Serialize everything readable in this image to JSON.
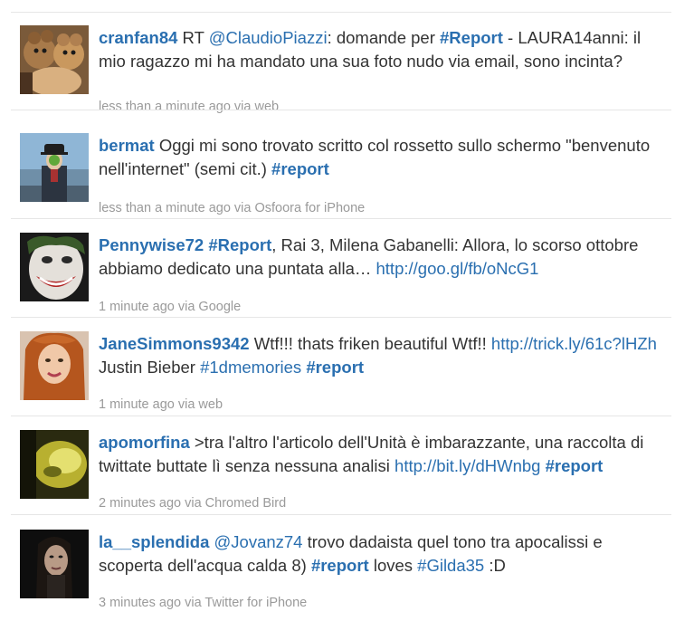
{
  "tweets": [
    {
      "user": "cranfan84",
      "segments": [
        {
          "type": "text",
          "text": " RT "
        },
        {
          "type": "mention",
          "text": "@ClaudioPiazzi"
        },
        {
          "type": "text",
          "text": ": domande per "
        },
        {
          "type": "hashtag",
          "text": "#Report"
        },
        {
          "type": "text",
          "text": " - LAURA14anni: il mio ragazzo mi ha mandato una sua foto nudo via email, sono incinta?"
        }
      ],
      "meta": "less than a minute ago via web",
      "avatar": "teddy-bear-avatar"
    },
    {
      "user": "bermat",
      "segments": [
        {
          "type": "text",
          "text": " Oggi mi sono trovato scritto col rossetto sullo schermo \"benvenuto nell'internet\" (semi cit.) "
        },
        {
          "type": "hashtag",
          "text": "#report"
        }
      ],
      "meta": "less than a minute ago via Osfoora for iPhone",
      "avatar": "magritte-man-avatar"
    },
    {
      "user": "Pennywise72",
      "segments": [
        {
          "type": "text",
          "text": " "
        },
        {
          "type": "hashtag",
          "text": "#Report"
        },
        {
          "type": "text",
          "text": ", Rai 3, Milena Gabanelli: Allora, lo scorso ottobre abbiamo dedicato una puntata alla… "
        },
        {
          "type": "link",
          "text": "http://goo.gl/fb/oNcG1"
        }
      ],
      "meta": "1 minute ago via Google",
      "avatar": "joker-face-avatar"
    },
    {
      "user": "JaneSimmons9342",
      "segments": [
        {
          "type": "text",
          "text": " Wtf!!! thats friken beautiful Wtf!! "
        },
        {
          "type": "link",
          "text": "http://trick.ly/61c?lHZh"
        },
        {
          "type": "text",
          "text": " Justin Bieber "
        },
        {
          "type": "tag",
          "text": "#1dmemories"
        },
        {
          "type": "text",
          "text": " "
        },
        {
          "type": "hashtag",
          "text": "#report"
        }
      ],
      "meta": "1 minute ago via web",
      "avatar": "redhead-woman-avatar"
    },
    {
      "user": "apomorfina",
      "segments": [
        {
          "type": "text",
          "text": " >tra l'altro l'articolo dell'Unità è imbarazzante, una raccolta di twittate buttate lì senza nessuna analisi "
        },
        {
          "type": "link",
          "text": "http://bit.ly/dHWnbg"
        },
        {
          "type": "text",
          "text": " "
        },
        {
          "type": "hashtag",
          "text": "#report"
        }
      ],
      "meta": "2 minutes ago via Chromed Bird",
      "avatar": "yellow-blur-avatar"
    },
    {
      "user": "la__splendida",
      "segments": [
        {
          "type": "text",
          "text": " "
        },
        {
          "type": "mention",
          "text": "@Jovanz74"
        },
        {
          "type": "text",
          "text": " trovo dadaista quel tono tra apocalissi e scoperta dell'acqua calda 8) "
        },
        {
          "type": "hashtag",
          "text": "#report"
        },
        {
          "type": "text",
          "text": " loves "
        },
        {
          "type": "tag",
          "text": "#Gilda35"
        },
        {
          "type": "text",
          "text": " :D"
        }
      ],
      "meta": "3 minutes ago via Twitter for iPhone",
      "avatar": "dark-woman-avatar"
    }
  ],
  "colors": {
    "link": "#2a6fb0",
    "text": "#333333",
    "meta": "#9a9a9a",
    "separator": "#e6e6e6"
  }
}
